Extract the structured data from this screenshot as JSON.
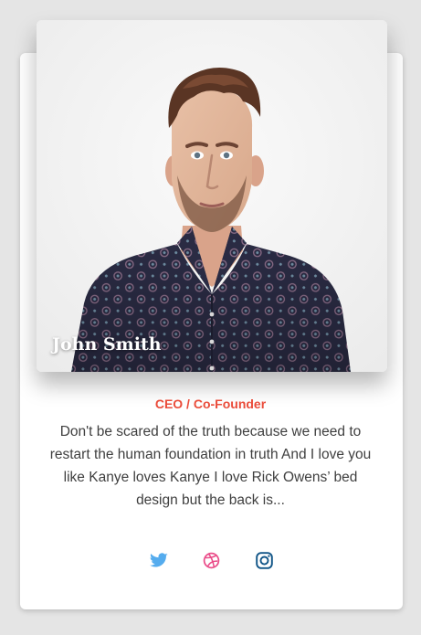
{
  "profile": {
    "name": "John Smith",
    "title": "CEO / Co-Founder",
    "bio": "Don't be scared of the truth because we need to restart the human foundation in truth And I love you like Kanye loves Kanye I love Rick Owens’ bed design but the back is..."
  },
  "social_links": [
    {
      "icon": "twitter-icon",
      "color": "#55acee"
    },
    {
      "icon": "dribbble-icon",
      "color": "#ea4c89"
    },
    {
      "icon": "instagram-icon",
      "color": "#125688"
    }
  ],
  "colors": {
    "page_background": "#e5e5e5",
    "card_background": "#ffffff",
    "accent": "#ea4c3a",
    "bio_text": "#3f3f3f",
    "name_text": "#ffffff"
  }
}
